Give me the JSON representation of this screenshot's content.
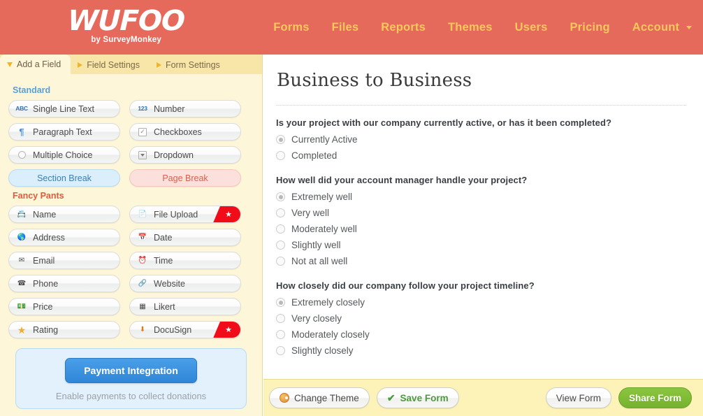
{
  "header": {
    "logo_word": "WUFOO",
    "logo_sub": "by SurveyMonkey",
    "nav": [
      {
        "label": "Forms",
        "icon": ""
      },
      {
        "label": "Files",
        "icon": ""
      },
      {
        "label": "Reports",
        "icon": ""
      },
      {
        "label": "Themes",
        "icon": ""
      },
      {
        "label": "Users",
        "icon": ""
      },
      {
        "label": "Pricing",
        "icon": ""
      },
      {
        "label": "Account",
        "icon": "caret-down-icon"
      }
    ],
    "bg_color": "#e66a5c",
    "nav_color": "#f6c85c"
  },
  "sidebar": {
    "tabs": [
      {
        "label": "Add a Field",
        "active": true,
        "marker": "triangle-down-icon"
      },
      {
        "label": "Field Settings",
        "active": false,
        "marker": "triangle-right-icon"
      },
      {
        "label": "Form Settings",
        "active": false,
        "marker": "triangle-right-icon"
      }
    ],
    "standard": {
      "title": "Standard",
      "title_color": "#5b9fd4",
      "fields": [
        {
          "label": "Single Line Text",
          "icon": "abc-icon",
          "style": "normal"
        },
        {
          "label": "Number",
          "icon": "123-icon",
          "style": "normal"
        },
        {
          "label": "Paragraph Text",
          "icon": "pilcrow-icon",
          "style": "normal"
        },
        {
          "label": "Checkboxes",
          "icon": "checkbox-icon",
          "style": "normal"
        },
        {
          "label": "Multiple Choice",
          "icon": "radio-circle-icon",
          "style": "normal"
        },
        {
          "label": "Dropdown",
          "icon": "dropdown-icon",
          "style": "normal"
        },
        {
          "label": "Section Break",
          "icon": "",
          "style": "section-break"
        },
        {
          "label": "Page Break",
          "icon": "",
          "style": "page-break"
        }
      ]
    },
    "fancy": {
      "title": "Fancy Pants",
      "title_color": "#e05a3d",
      "fields": [
        {
          "label": "Name",
          "icon": "id-card-icon",
          "glyph": "📇",
          "premium": false
        },
        {
          "label": "File Upload",
          "icon": "file-upload-icon",
          "glyph": "📄",
          "premium": true
        },
        {
          "label": "Address",
          "icon": "globe-icon",
          "glyph": "🌎",
          "premium": false
        },
        {
          "label": "Date",
          "icon": "calendar-icon",
          "glyph": "📅",
          "premium": false
        },
        {
          "label": "Email",
          "icon": "envelope-icon",
          "glyph": "✉",
          "premium": false
        },
        {
          "label": "Time",
          "icon": "alarm-clock-icon",
          "glyph": "⏰",
          "premium": false
        },
        {
          "label": "Phone",
          "icon": "telephone-icon",
          "glyph": "☎",
          "premium": false
        },
        {
          "label": "Website",
          "icon": "link-icon",
          "glyph": "🔗",
          "premium": false
        },
        {
          "label": "Price",
          "icon": "money-icon",
          "glyph": "💵",
          "premium": false
        },
        {
          "label": "Likert",
          "icon": "grid-table-icon",
          "glyph": "▦",
          "premium": false
        },
        {
          "label": "Rating",
          "icon": "star-icon",
          "glyph": "★",
          "premium": false
        },
        {
          "label": "DocuSign",
          "icon": "docusign-icon",
          "glyph": "⬇",
          "premium": true
        }
      ]
    },
    "payment": {
      "button_label": "Payment Integration",
      "note": "Enable payments to collect donations"
    }
  },
  "main": {
    "form_title": "Business to Business",
    "questions": [
      {
        "label": "Is your project with our company currently active, or has it been completed?",
        "options": [
          {
            "label": "Currently Active",
            "checked": true
          },
          {
            "label": "Completed",
            "checked": false
          }
        ]
      },
      {
        "label": "How well did your account manager handle your project?",
        "options": [
          {
            "label": "Extremely well",
            "checked": true
          },
          {
            "label": "Very well",
            "checked": false
          },
          {
            "label": "Moderately well",
            "checked": false
          },
          {
            "label": "Slightly well",
            "checked": false
          },
          {
            "label": "Not at all well",
            "checked": false
          }
        ]
      },
      {
        "label": "How closely did our company follow your project timeline?",
        "options": [
          {
            "label": "Extremely closely",
            "checked": true
          },
          {
            "label": "Very closely",
            "checked": false
          },
          {
            "label": "Moderately closely",
            "checked": false
          },
          {
            "label": "Slightly closely",
            "checked": false
          }
        ]
      }
    ]
  },
  "footer": {
    "change_theme": "Change Theme",
    "save_form": "Save Form",
    "view_form": "View Form",
    "share_form": "Share Form",
    "share_color": "#8cc63f"
  }
}
